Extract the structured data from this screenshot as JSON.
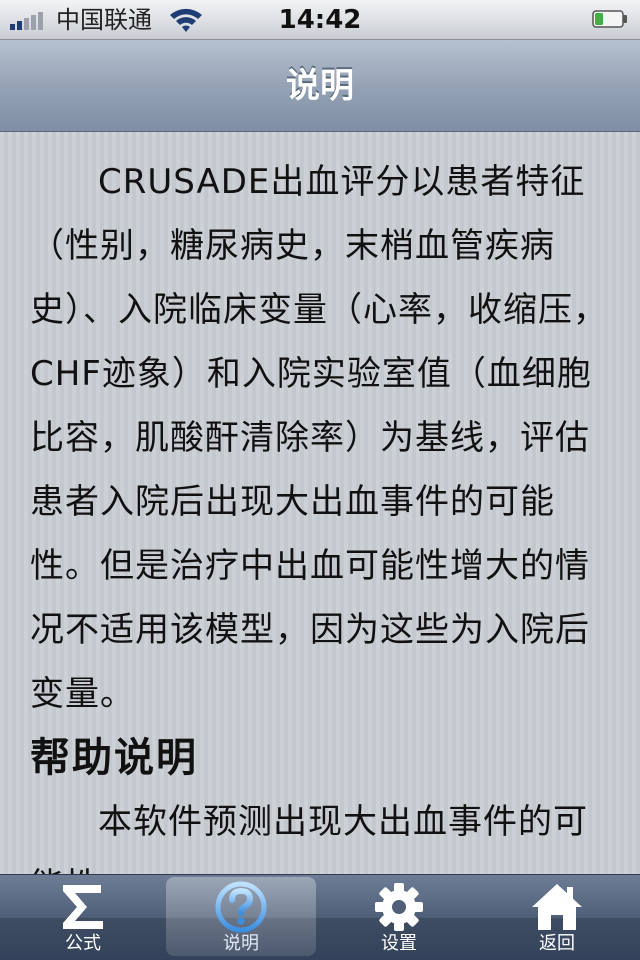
{
  "status_bar": {
    "carrier": "中国联通",
    "time": "14:42",
    "signal_bars": 5,
    "signal_active": 2
  },
  "nav_bar": {
    "title": "说明"
  },
  "content": {
    "intro": "CRUSADE出血评分以患者特征（性别，糖尿病史，末梢血管疾病史）、入院临床变量（心率，收缩压，CHF迹象）和入院实验室值（血细胞比容，肌酸酐清除率）为基线，评估患者入院后出现大出血事件的可能性。但是治疗中出血可能性增大的情况不适用该模型，因为这些为入院后变量。",
    "help_heading": "帮助说明",
    "help_text": "本软件预测出现大出血事件的可能性。"
  },
  "tab_bar": {
    "tabs": [
      {
        "label": "公式",
        "icon": "sigma-icon",
        "active": false
      },
      {
        "label": "说明",
        "icon": "help-icon",
        "active": true
      },
      {
        "label": "设置",
        "icon": "gear-icon",
        "active": false
      },
      {
        "label": "返回",
        "icon": "home-icon",
        "active": false
      }
    ]
  },
  "colors": {
    "nav_bar": "#96a3b6",
    "tab_bar": "#4f5f77",
    "content_bg": "#c8ccd2",
    "text": "#111111"
  }
}
